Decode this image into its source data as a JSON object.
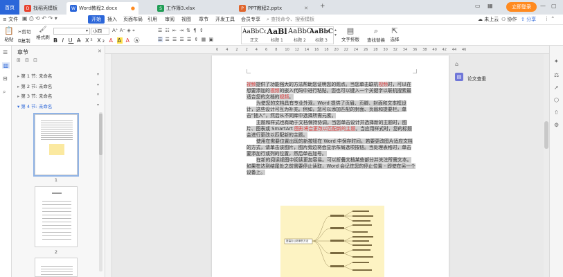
{
  "tabbar": {
    "home_label": "首页",
    "tabs": [
      {
        "icon": "template-icon",
        "label": "找稻壳模板",
        "color": "#e8412c"
      },
      {
        "icon": "word-icon",
        "label": "Word教程2.docx",
        "color": "#2b66d9"
      },
      {
        "icon": "excel-icon",
        "label": "工作簿3.xlsx",
        "color": "#1f9d55"
      },
      {
        "icon": "ppt-icon",
        "label": "PPT教程2.pptx",
        "color": "#e0652c"
      }
    ],
    "login_label": "立即登录"
  },
  "menubar": {
    "file_label": "文件",
    "items": [
      "开始",
      "插入",
      "页面布局",
      "引用",
      "审阅",
      "视图",
      "章节",
      "开发工具",
      "会员专享"
    ],
    "search_placeholder": "查找命令、搜索模板",
    "right_items": [
      "未上云",
      "协作",
      "分享"
    ]
  },
  "ribbon": {
    "paste_label": "粘贴",
    "cut_label": "剪切",
    "copy_label": "复制",
    "format_painter_label": "格式刷",
    "font_size_value": "小四",
    "styles": [
      {
        "preview": "AaBbCcI",
        "label": "正文"
      },
      {
        "preview": "AaBl",
        "label": "标题 1"
      },
      {
        "preview": "AaBbC",
        "label": "标题 2"
      },
      {
        "preview": "AaBbC",
        "label": "标题 3"
      }
    ],
    "text_layout_label": "文字排版",
    "find_replace_label": "查找替换",
    "select_label": "选择"
  },
  "nav": {
    "title": "章节",
    "items": [
      {
        "label": "第 1 节: 未命名"
      },
      {
        "label": "第 2 节: 未命名"
      },
      {
        "label": "第 3 节: 未命名"
      },
      {
        "label": "第 4 节: 未命名"
      }
    ],
    "pages": [
      "1",
      "2"
    ]
  },
  "ruler": {
    "ticks": [
      "6",
      "4",
      "2",
      "2",
      "4",
      "6",
      "8",
      "10",
      "12",
      "14",
      "16",
      "18",
      "20",
      "22",
      "24",
      "26",
      "28",
      "30",
      "32",
      "34",
      "36",
      "38",
      "40",
      "42",
      "44",
      "46"
    ]
  },
  "document": {
    "paragraphs": [
      [
        {
          "t": "视频",
          "c": "red"
        },
        {
          "t": "提供了功能强大的方法帮助您证明您的观点。当您单击联机",
          "c": ""
        },
        {
          "t": "视频",
          "c": "red"
        },
        {
          "t": "时，可以在想要添加的",
          "c": ""
        },
        {
          "t": "视频",
          "c": "red"
        },
        {
          "t": "的嵌入代码中进行粘贴。您也可以键入一个关键字以联机搜索最适合您的文档的",
          "c": ""
        },
        {
          "t": "视频",
          "c": "red"
        },
        {
          "t": "。",
          "c": ""
        }
      ],
      [
        {
          "t": "为使您的文档具有专业外观，Word 提供了页眉、页脚、封面和文本框设计，这些设计可互为补充。例如，您可以添加匹配的封面、页眉和提要栏。单击“插入”，然后从不同库中选择所需元素。",
          "c": ""
        }
      ],
      [
        {
          "t": "主题和样式也有助于文档保持协调。当您单击设计并选择新的主题时，图片、图表或 SmartArt ",
          "c": ""
        },
        {
          "t": "图形将会更改以匹配新的主题",
          "c": "red"
        },
        {
          "t": "。当应用样式时，您的标题会进行更改以匹配新的主题。",
          "c": ""
        }
      ],
      [
        {
          "t": "使用在需要位置出现的新按钮在 Word 中保存时间。若要更改图片适应文档的方式，请单击该图片，图片旁边将会显示布局选项按钮。当处理表格时，单击要添加行或列的位置，然后单击加号。",
          "c": ""
        }
      ],
      [
        {
          "t": "在新的阅读视图中阅读更加容易。可以折叠文档某些部分并关注所需文本。如果在达到结尾处之前需要停止读取，Word 会记住您的停止位置 - 即使在另一个设备上。",
          "c": ""
        }
      ]
    ]
  },
  "mindmap": {
    "root_label": "提高办公效率的方法"
  },
  "right_panel": {
    "paper_check_label": "论文查重"
  },
  "colors": {
    "brand_blue": "#2b66d9",
    "login_orange": "#ff8a1f",
    "highlight_red": "#e03b3b",
    "selection_gray": "#cfcfcf",
    "mindmap_bg": "#fdf3c3"
  }
}
